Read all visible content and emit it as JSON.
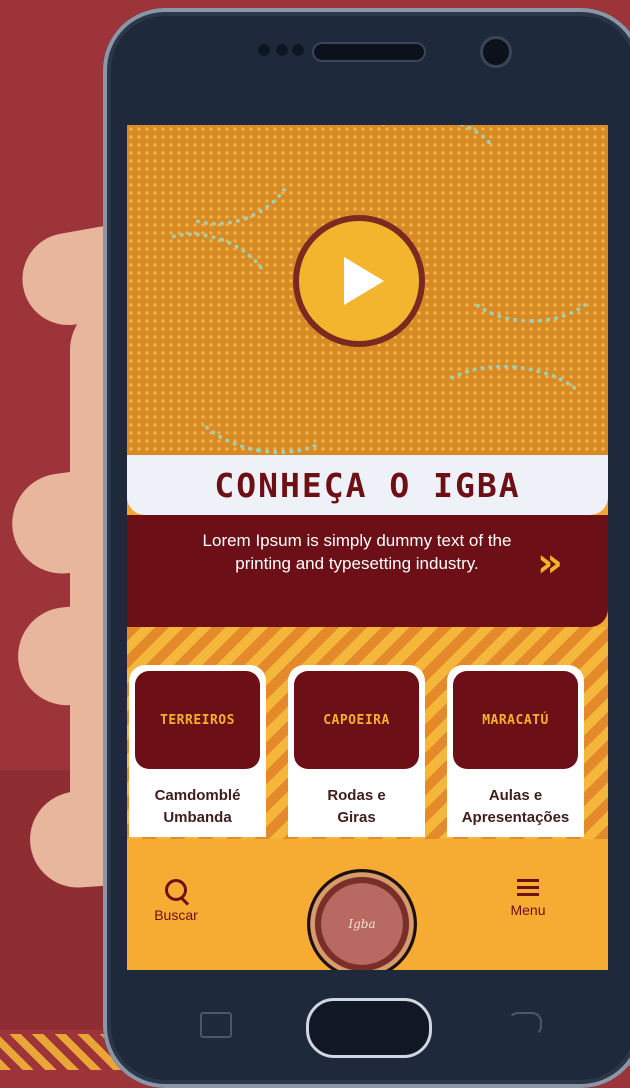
{
  "hero": {
    "play_label": ""
  },
  "title": "CONHEÇA O IGBA",
  "description": "Lorem Ipsum is simply dummy text of the printing and typesetting industry.",
  "cards": [
    {
      "title": "TERREIROS",
      "line1": "Camdomblé",
      "line2": "Umbanda"
    },
    {
      "title": "CAPOEIRA",
      "line1": "Rodas e",
      "line2": "Giras"
    },
    {
      "title": "MARACATÚ",
      "line1": "Aulas e",
      "line2": "Apresentações"
    }
  ],
  "nav": {
    "search_label": "Buscar",
    "menu_label": "Menu",
    "logo_text": "Igba"
  },
  "colors": {
    "accent": "#6c0f16",
    "gold": "#f2b22e",
    "background": "#9c3439"
  },
  "icons": {
    "play": "play-icon",
    "more": "double-chevron-right-icon",
    "search": "search-icon",
    "menu": "hamburger-menu-icon"
  }
}
